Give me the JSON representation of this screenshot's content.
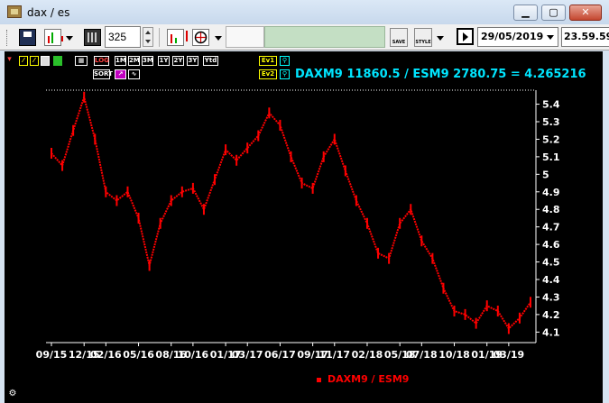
{
  "window": {
    "title": "dax / es",
    "buttons": {
      "minimize": "▁",
      "maximize": "▢",
      "close": "✕"
    }
  },
  "toolbar": {
    "period_value": "325",
    "button_save_label": "SAVE",
    "button_style_label": "STYLE",
    "date_value": "29/05/2019",
    "time_value": "23.59.59"
  },
  "chart_toolbar": {
    "log_label": "LOG",
    "sort_label": "SORT",
    "ranges": [
      "1M",
      "2M",
      "3M",
      "1Y",
      "2Y",
      "3Y",
      "Ytd"
    ],
    "ev1_label": "Ev1",
    "ev2_label": "Ev2"
  },
  "header_text": "DAXM9 11860.5 / ESM9 2780.75 = 4.265216",
  "accent_colors": {
    "series": "#ff0000",
    "header": "#00e5ff",
    "background": "#000000"
  },
  "chart_data": {
    "type": "line",
    "series": [
      {
        "name": "DAXM9 / ESM9",
        "color": "#ff0000"
      }
    ],
    "x_tick_labels": [
      "09/15",
      "12/15",
      "02/16",
      "05/16",
      "08/16",
      "10/16",
      "01/17",
      "03/17",
      "06/17",
      "09/17",
      "11/17",
      "02/18",
      "05/18",
      "07/18",
      "10/18",
      "01/19",
      "03/19"
    ],
    "y_tick_labels": [
      "5.4",
      "5.3",
      "5.2",
      "5.1",
      "5",
      "4.9",
      "4.8",
      "4.7",
      "4.6",
      "4.5",
      "4.4",
      "4.3",
      "4.2",
      "4.1"
    ],
    "ylim": [
      4.04,
      5.48
    ],
    "points": [
      [
        "09/15",
        5.12
      ],
      [
        "10/15",
        5.05
      ],
      [
        "11/15",
        5.25
      ],
      [
        "12/15",
        5.44
      ],
      [
        "01/16",
        5.2
      ],
      [
        "02/16",
        4.9
      ],
      [
        "03/16",
        4.85
      ],
      [
        "04/16",
        4.9
      ],
      [
        "05/16",
        4.75
      ],
      [
        "06/16",
        4.48
      ],
      [
        "07/16",
        4.72
      ],
      [
        "08/16",
        4.85
      ],
      [
        "09/16",
        4.9
      ],
      [
        "10/16",
        4.92
      ],
      [
        "11/16",
        4.8
      ],
      [
        "12/16",
        4.97
      ],
      [
        "01/17",
        5.14
      ],
      [
        "02/17",
        5.08
      ],
      [
        "03/17",
        5.15
      ],
      [
        "04/17",
        5.22
      ],
      [
        "05/17",
        5.35
      ],
      [
        "06/17",
        5.28
      ],
      [
        "07/17",
        5.1
      ],
      [
        "08/17",
        4.95
      ],
      [
        "09/17",
        4.92
      ],
      [
        "10/17",
        5.1
      ],
      [
        "11/17",
        5.2
      ],
      [
        "12/17",
        5.02
      ],
      [
        "01/18",
        4.85
      ],
      [
        "02/18",
        4.72
      ],
      [
        "03/18",
        4.55
      ],
      [
        "04/18",
        4.52
      ],
      [
        "05/18",
        4.72
      ],
      [
        "06/18",
        4.8
      ],
      [
        "07/18",
        4.62
      ],
      [
        "08/18",
        4.52
      ],
      [
        "09/18",
        4.35
      ],
      [
        "10/18",
        4.22
      ],
      [
        "11/18",
        4.2
      ],
      [
        "12/18",
        4.15
      ],
      [
        "01/19",
        4.25
      ],
      [
        "02/19",
        4.22
      ],
      [
        "03/19",
        4.12
      ],
      [
        "04/19",
        4.18
      ],
      [
        "05/19",
        4.27
      ]
    ]
  }
}
